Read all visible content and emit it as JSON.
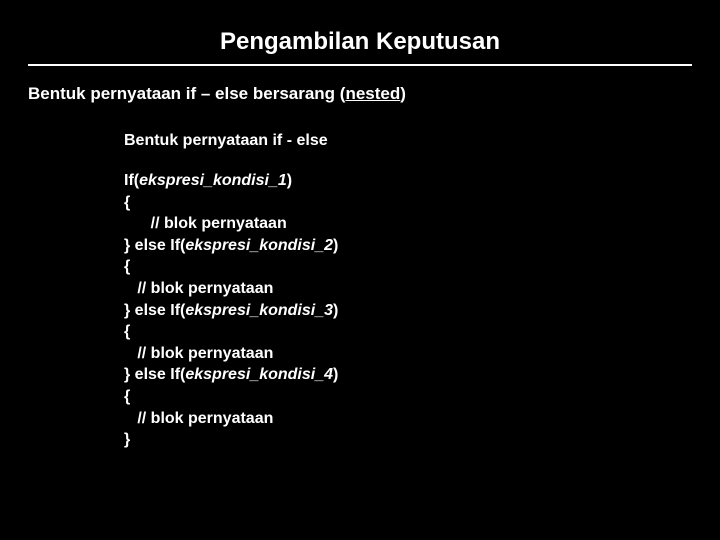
{
  "title": "Pengambilan Keputusan",
  "subtitle": {
    "prefix": "Bentuk pernyataan if – else bersarang (",
    "underlined": "nested",
    "suffix": ")"
  },
  "section_heading": "Bentuk pernyataan if - else",
  "code": {
    "l1a": "If(",
    "l1b": "ekspresi_kondisi_1",
    "l1c": ")",
    "l2": "{",
    "l3": "      // blok pernyataan",
    "l4a": "} else If(",
    "l4b": "ekspresi_kondisi_2",
    "l4c": ")",
    "l5": "{",
    "l6": "   // blok pernyataan",
    "l7a": "} else If(",
    "l7b": "ekspresi_kondisi_3",
    "l7c": ")",
    "l8": "{",
    "l9": "   // blok pernyataan",
    "l10a": "} else If(",
    "l10b": "ekspresi_kondisi_4",
    "l10c": ")",
    "l11": "{",
    "l12": "   // blok pernyataan",
    "l13": "}"
  }
}
